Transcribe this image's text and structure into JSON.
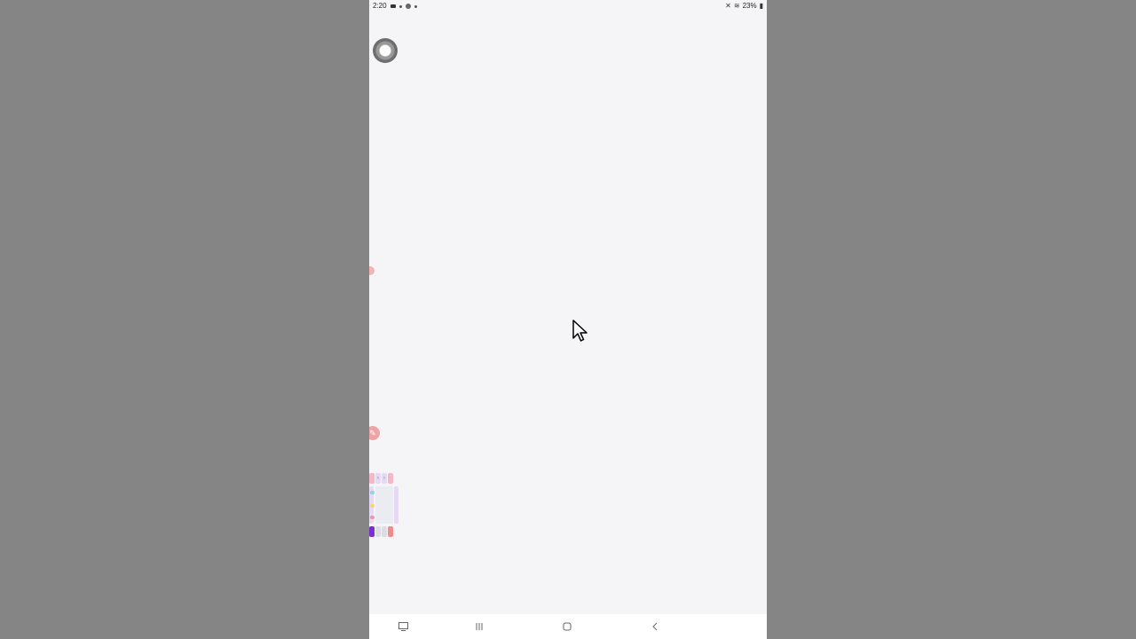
{
  "status_bar": {
    "time": "2:20",
    "battery": "23%"
  },
  "icons": {
    "recent_apps": "recent-apps-icon",
    "home": "home-icon",
    "back": "back-icon",
    "keyboard": "keyboard-icon"
  },
  "colors": {
    "screen_bg": "#f5f5f8",
    "outer_bg": "#858585",
    "accent_pink": "#eea4a4",
    "accent_purple": "#7a2fd0"
  }
}
